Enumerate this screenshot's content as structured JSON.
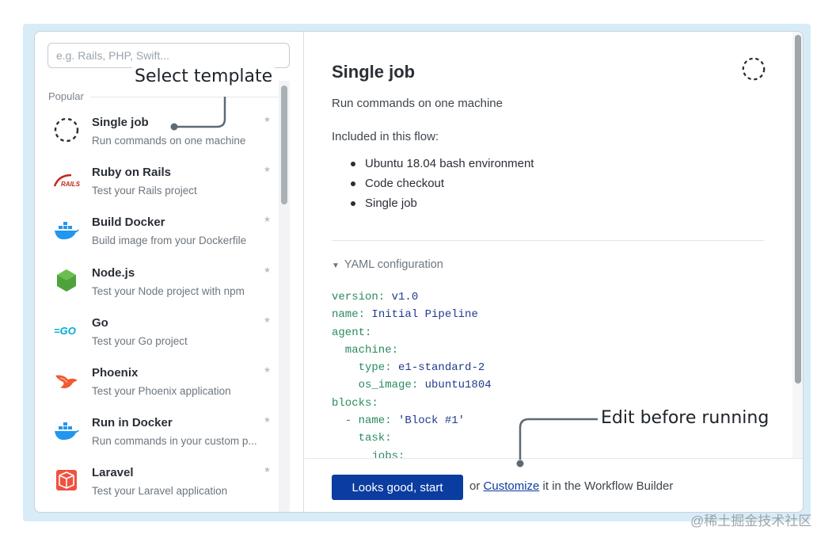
{
  "search": {
    "placeholder": "e.g. Rails, PHP, Swift..."
  },
  "left": {
    "section_label": "Popular",
    "items": [
      {
        "name": "Single job",
        "desc": "Run commands on one machine",
        "icon": "dashed-circle-icon"
      },
      {
        "name": "Ruby on Rails",
        "desc": "Test your Rails project",
        "icon": "rails-icon"
      },
      {
        "name": "Build Docker",
        "desc": "Build image from your Dockerfile",
        "icon": "docker-icon"
      },
      {
        "name": "Node.js",
        "desc": "Test your Node project with npm",
        "icon": "nodejs-icon"
      },
      {
        "name": "Go",
        "desc": "Test your Go project",
        "icon": "go-icon"
      },
      {
        "name": "Phoenix",
        "desc": "Test your Phoenix application",
        "icon": "phoenix-icon"
      },
      {
        "name": "Run in Docker",
        "desc": "Run commands in your custom p...",
        "icon": "docker-icon"
      },
      {
        "name": "Laravel",
        "desc": "Test your Laravel application",
        "icon": "laravel-icon"
      }
    ],
    "rails_logo_text": "RAILS",
    "go_logo_text": "=GO"
  },
  "detail": {
    "title": "Single job",
    "subtitle": "Run commands on one machine",
    "included_label": "Included in this flow:",
    "included": [
      "Ubuntu 18.04 bash environment",
      "Code checkout",
      "Single job"
    ],
    "yaml_toggle": "YAML configuration",
    "yaml_lines": [
      {
        "key": "version:",
        "value": " v1.0"
      },
      {
        "key": "name:",
        "value": " Initial Pipeline"
      },
      {
        "key": "agent:",
        "value": ""
      },
      {
        "key": "  machine:",
        "value": ""
      },
      {
        "key": "    type:",
        "value": " e1-standard-2"
      },
      {
        "key": "    os_image:",
        "value": " ubuntu1804"
      },
      {
        "key": "blocks:",
        "value": ""
      },
      {
        "key": "  - name:",
        "value": " 'Block #1'"
      },
      {
        "key": "    task:",
        "value": ""
      },
      {
        "key": "      jobs:",
        "value": ""
      }
    ]
  },
  "footer": {
    "start_label": "Looks good, start",
    "or_text": "or ",
    "customize_link": "Customize",
    "rest_text": " it in the Workflow Builder"
  },
  "annotations": {
    "select_template": "Select template",
    "edit_before_running": "Edit before running"
  },
  "watermark": "@稀土掘金技术社区",
  "colors": {
    "frame_bg": "#d8ecf7",
    "primary_button": "#0b3ca0",
    "yaml_key": "#2a8a5f",
    "yaml_value": "#213b8c"
  }
}
